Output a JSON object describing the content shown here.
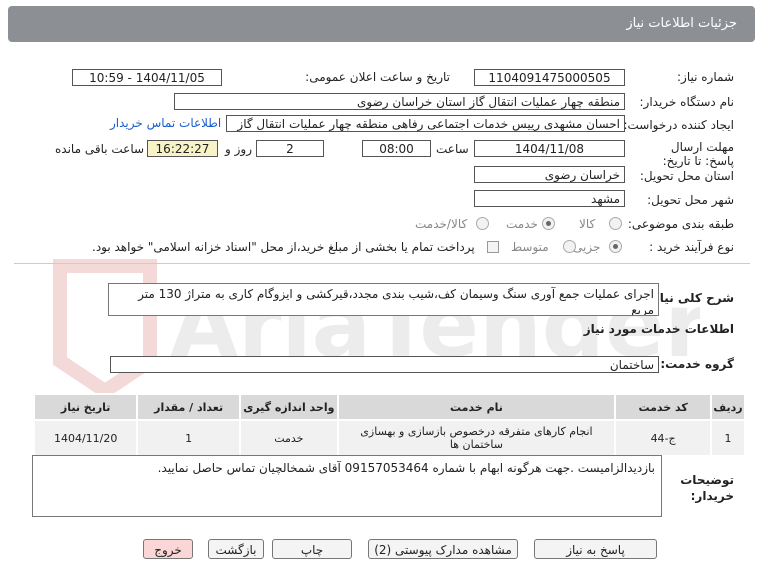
{
  "header": {
    "title": "جزئیات اطلاعات نیاز"
  },
  "fields": {
    "need_number_label": "شماره نیاز:",
    "need_number": "1104091475000505",
    "announce_label": "تاریخ و ساعت اعلان عمومی:",
    "announce_value": "1404/11/05 - 10:59",
    "buyer_org_label": "نام دستگاه خریدار:",
    "buyer_org": "منطقه چهار عملیات انتقال گاز    استان خراسان رضوی",
    "requester_label": "ایجاد کننده درخواست:",
    "requester": "احسان مشهدی رییس خدمات اجتماعی رفاهی منطقه چهار عملیات انتقال گاز",
    "contact_link": "اطلاعات تماس خریدار",
    "deadline_label": "مهلت ارسال پاسخ: تا تاریخ:",
    "deadline_date": "1404/11/08",
    "time_label": "ساعت",
    "deadline_time": "08:00",
    "days_value": "2",
    "days_label": "روز و",
    "remaining_time": "16:22:27",
    "remaining_label": "ساعت باقی مانده",
    "province_label": "استان محل تحویل:",
    "province": "خراسان رضوی",
    "city_label": "شهر محل تحویل:",
    "city": "مشهد",
    "category_label": "طبقه بندی موضوعی:",
    "category_options": [
      "کالا",
      "خدمت",
      "کالا/خدمت"
    ],
    "category_selected": "خدمت",
    "process_label": "نوع فرآیند خرید :",
    "process_options": [
      "جزیی",
      "متوسط"
    ],
    "process_selected": "جزیی",
    "payment_note": "پرداخت تمام یا بخشی از مبلغ خرید،از محل \"اسناد خزانه اسلامی\" خواهد بود."
  },
  "description": {
    "label": "شرح کلی نیاز:",
    "text": "اجرای عملیات جمع آوری سنگ وسیمان کف،شیب بندی مجدد،قیرکشی و ایزوگام کاری به متراژ 130 متر مربع"
  },
  "services": {
    "section_title": "اطلاعات خدمات مورد نیاز",
    "group_label": "گروه خدمت:",
    "group_value": "ساختمان",
    "columns": [
      "ردیف",
      "کد خدمت",
      "نام خدمت",
      "واحد اندازه گیری",
      "تعداد / مقدار",
      "تاریخ نیاز"
    ],
    "rows": [
      {
        "row": "1",
        "code": "ج-44",
        "name": "انجام کارهای متفرقه درخصوص بازسازی و بهسازی ساختمان ها",
        "unit": "خدمت",
        "qty": "1",
        "date": "1404/11/20"
      }
    ]
  },
  "buyer_notes": {
    "label": "توضیحات خریدار:",
    "text": "بازدیدالزامیست .جهت هرگونه ابهام با شماره 09157053464 آقای شمخالچیان تماس حاصل نمایید."
  },
  "buttons": {
    "reply": "پاسخ به نیاز",
    "documents": "مشاهده مدارک پیوستی (2)",
    "print": "چاپ",
    "back": "بازگشت",
    "exit": "خروج"
  },
  "watermark": {
    "text": "AriaTender.net"
  },
  "colors": {
    "topbar": "#8c8f94",
    "link": "#1a5fd0",
    "remaining_bg": "#f7f3c6",
    "exit_bg": "#fbd6d6"
  }
}
